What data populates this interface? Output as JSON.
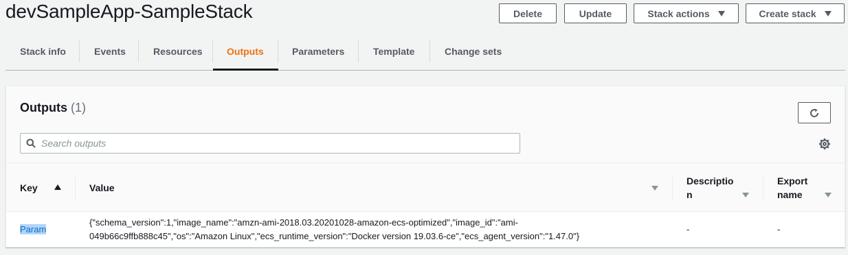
{
  "header": {
    "title": "devSampleApp-SampleStack",
    "delete_label": "Delete",
    "update_label": "Update",
    "stack_actions_label": "Stack actions",
    "create_stack_label": "Create stack"
  },
  "tabs": [
    {
      "label": "Stack info"
    },
    {
      "label": "Events"
    },
    {
      "label": "Resources"
    },
    {
      "label": "Outputs",
      "active": true
    },
    {
      "label": "Parameters"
    },
    {
      "label": "Template"
    },
    {
      "label": "Change sets"
    }
  ],
  "outputs": {
    "title": "Outputs",
    "count": "(1)",
    "search_placeholder": "Search outputs",
    "columns": {
      "key": "Key",
      "value": "Value",
      "description_line1": "Descriptio",
      "description_line2": "n",
      "export_line1": "Export",
      "export_line2": "name"
    },
    "rows": [
      {
        "key": "Param",
        "value_line1": "{\"schema_version\":1,\"image_name\":\"amzn-ami-2018.03.20201028-amazon-ecs-optimized\",\"image_id\":\"ami-",
        "value_line2": "049b66c9ffb888c45\",\"os\":\"Amazon Linux\",\"ecs_runtime_version\":\"Docker version 19.03.6-ce\",\"ecs_agent_version\":\"1.47.0\"}",
        "description": "-",
        "export_name": "-"
      }
    ]
  },
  "colors": {
    "active_tab": "#ec7211",
    "text": "#16191f",
    "secondary": "#545b64",
    "link": "#0073bb",
    "selection": "#b3d4fc"
  },
  "icons": {
    "refresh": "refresh-icon",
    "search": "search-icon",
    "settings": "gear-icon"
  }
}
